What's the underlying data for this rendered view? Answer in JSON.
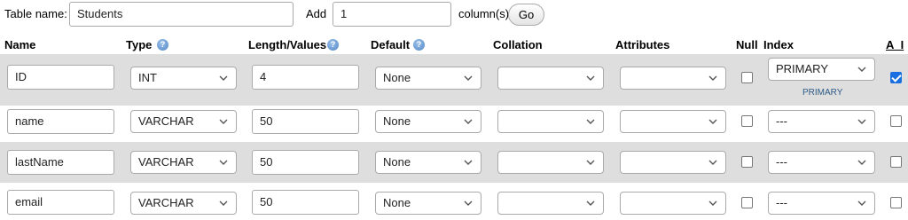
{
  "top": {
    "table_name_label": "Table name:",
    "table_name_value": "Students",
    "add_label": "Add",
    "add_value": "1",
    "columns_label": "column(s)",
    "go_label": "Go"
  },
  "headers": {
    "name": "Name",
    "type": "Type",
    "length": "Length/Values",
    "default": "Default",
    "collation": "Collation",
    "attributes": "Attributes",
    "null": "Null",
    "index": "Index",
    "ai": "A_I"
  },
  "rows": [
    {
      "name": "ID",
      "type": "INT",
      "length": "4",
      "default": "None",
      "collation": "",
      "attributes": "",
      "null": false,
      "index": "PRIMARY",
      "index_note": "PRIMARY",
      "ai": true
    },
    {
      "name": "name",
      "type": "VARCHAR",
      "length": "50",
      "default": "None",
      "collation": "",
      "attributes": "",
      "null": false,
      "index": "---",
      "index_note": "",
      "ai": false
    },
    {
      "name": "lastName",
      "type": "VARCHAR",
      "length": "50",
      "default": "None",
      "collation": "",
      "attributes": "",
      "null": false,
      "index": "---",
      "index_note": "",
      "ai": false
    },
    {
      "name": "email",
      "type": "VARCHAR",
      "length": "50",
      "default": "None",
      "collation": "",
      "attributes": "",
      "null": false,
      "index": "---",
      "index_note": "",
      "ai": false
    }
  ],
  "icons": {
    "help": "help-icon",
    "dropdown": "chevron-down-icon"
  },
  "colors": {
    "row_stripe": "#dedede",
    "checkbox_checked": "#1a6fe0",
    "link": "#2d5b86"
  }
}
